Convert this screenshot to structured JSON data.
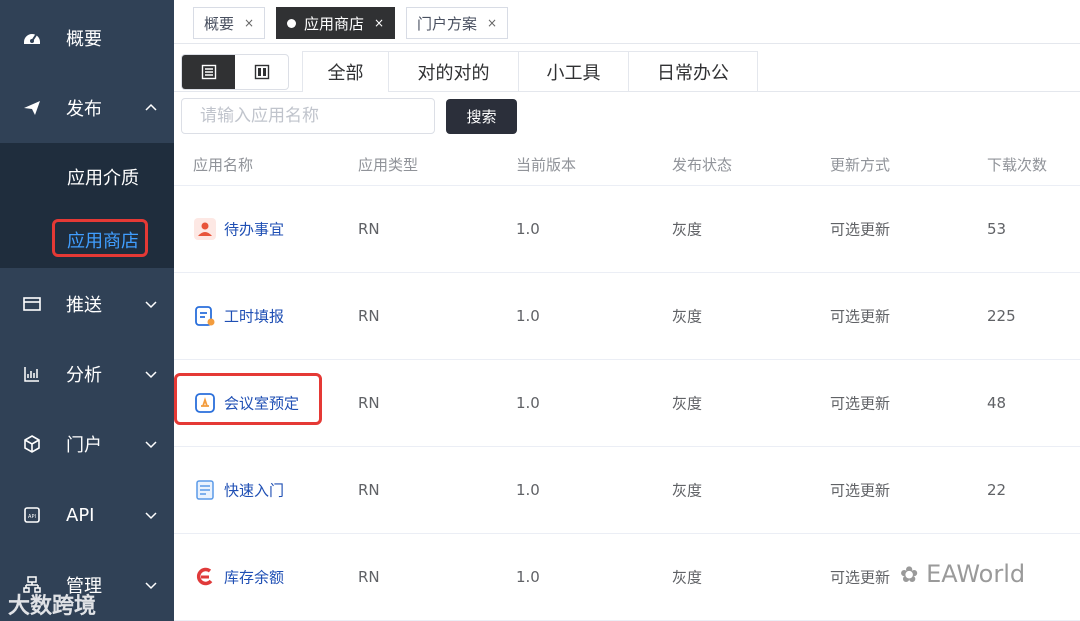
{
  "sidebar": {
    "items": [
      {
        "label": "概要",
        "icon": "dashboard-icon"
      },
      {
        "label": "发布",
        "icon": "send-icon"
      },
      {
        "label": "推送",
        "icon": "push-icon"
      },
      {
        "label": "分析",
        "icon": "chart-icon"
      },
      {
        "label": "门户",
        "icon": "cube-icon"
      },
      {
        "label": "API",
        "icon": "api-icon"
      },
      {
        "label": "管理",
        "icon": "manage-icon"
      }
    ],
    "submenu": [
      {
        "label": "应用介质"
      },
      {
        "label": "应用商店"
      }
    ]
  },
  "tags": [
    {
      "label": "概要",
      "close": "×"
    },
    {
      "label": "应用商店",
      "close": "×"
    },
    {
      "label": "门户方案",
      "close": "×"
    }
  ],
  "category_tabs": [
    "全部",
    "对的对的",
    "小工具",
    "日常办公"
  ],
  "search": {
    "placeholder": "请输入应用名称",
    "button": "搜索"
  },
  "table": {
    "headers": [
      "应用名称",
      "应用类型",
      "当前版本",
      "发布状态",
      "更新方式",
      "下载次数"
    ],
    "rows": [
      {
        "name": "待办事宜",
        "type": "RN",
        "version": "1.0",
        "status": "灰度",
        "update": "可选更新",
        "downloads": "53"
      },
      {
        "name": "工时填报",
        "type": "RN",
        "version": "1.0",
        "status": "灰度",
        "update": "可选更新",
        "downloads": "225"
      },
      {
        "name": "会议室预定",
        "type": "RN",
        "version": "1.0",
        "status": "灰度",
        "update": "可选更新",
        "downloads": "48"
      },
      {
        "name": "快速入门",
        "type": "RN",
        "version": "1.0",
        "status": "灰度",
        "update": "可选更新",
        "downloads": "22"
      },
      {
        "name": "库存余额",
        "type": "RN",
        "version": "1.0",
        "status": "灰度",
        "update": "可选更新",
        "downloads": ""
      }
    ]
  },
  "watermarks": {
    "left": "大数跨境",
    "right": "EAWorld"
  },
  "colors": {
    "sidebar": "#304156",
    "submenu": "#1f2d3d",
    "active": "#409eff",
    "highlight": "#e53935"
  }
}
